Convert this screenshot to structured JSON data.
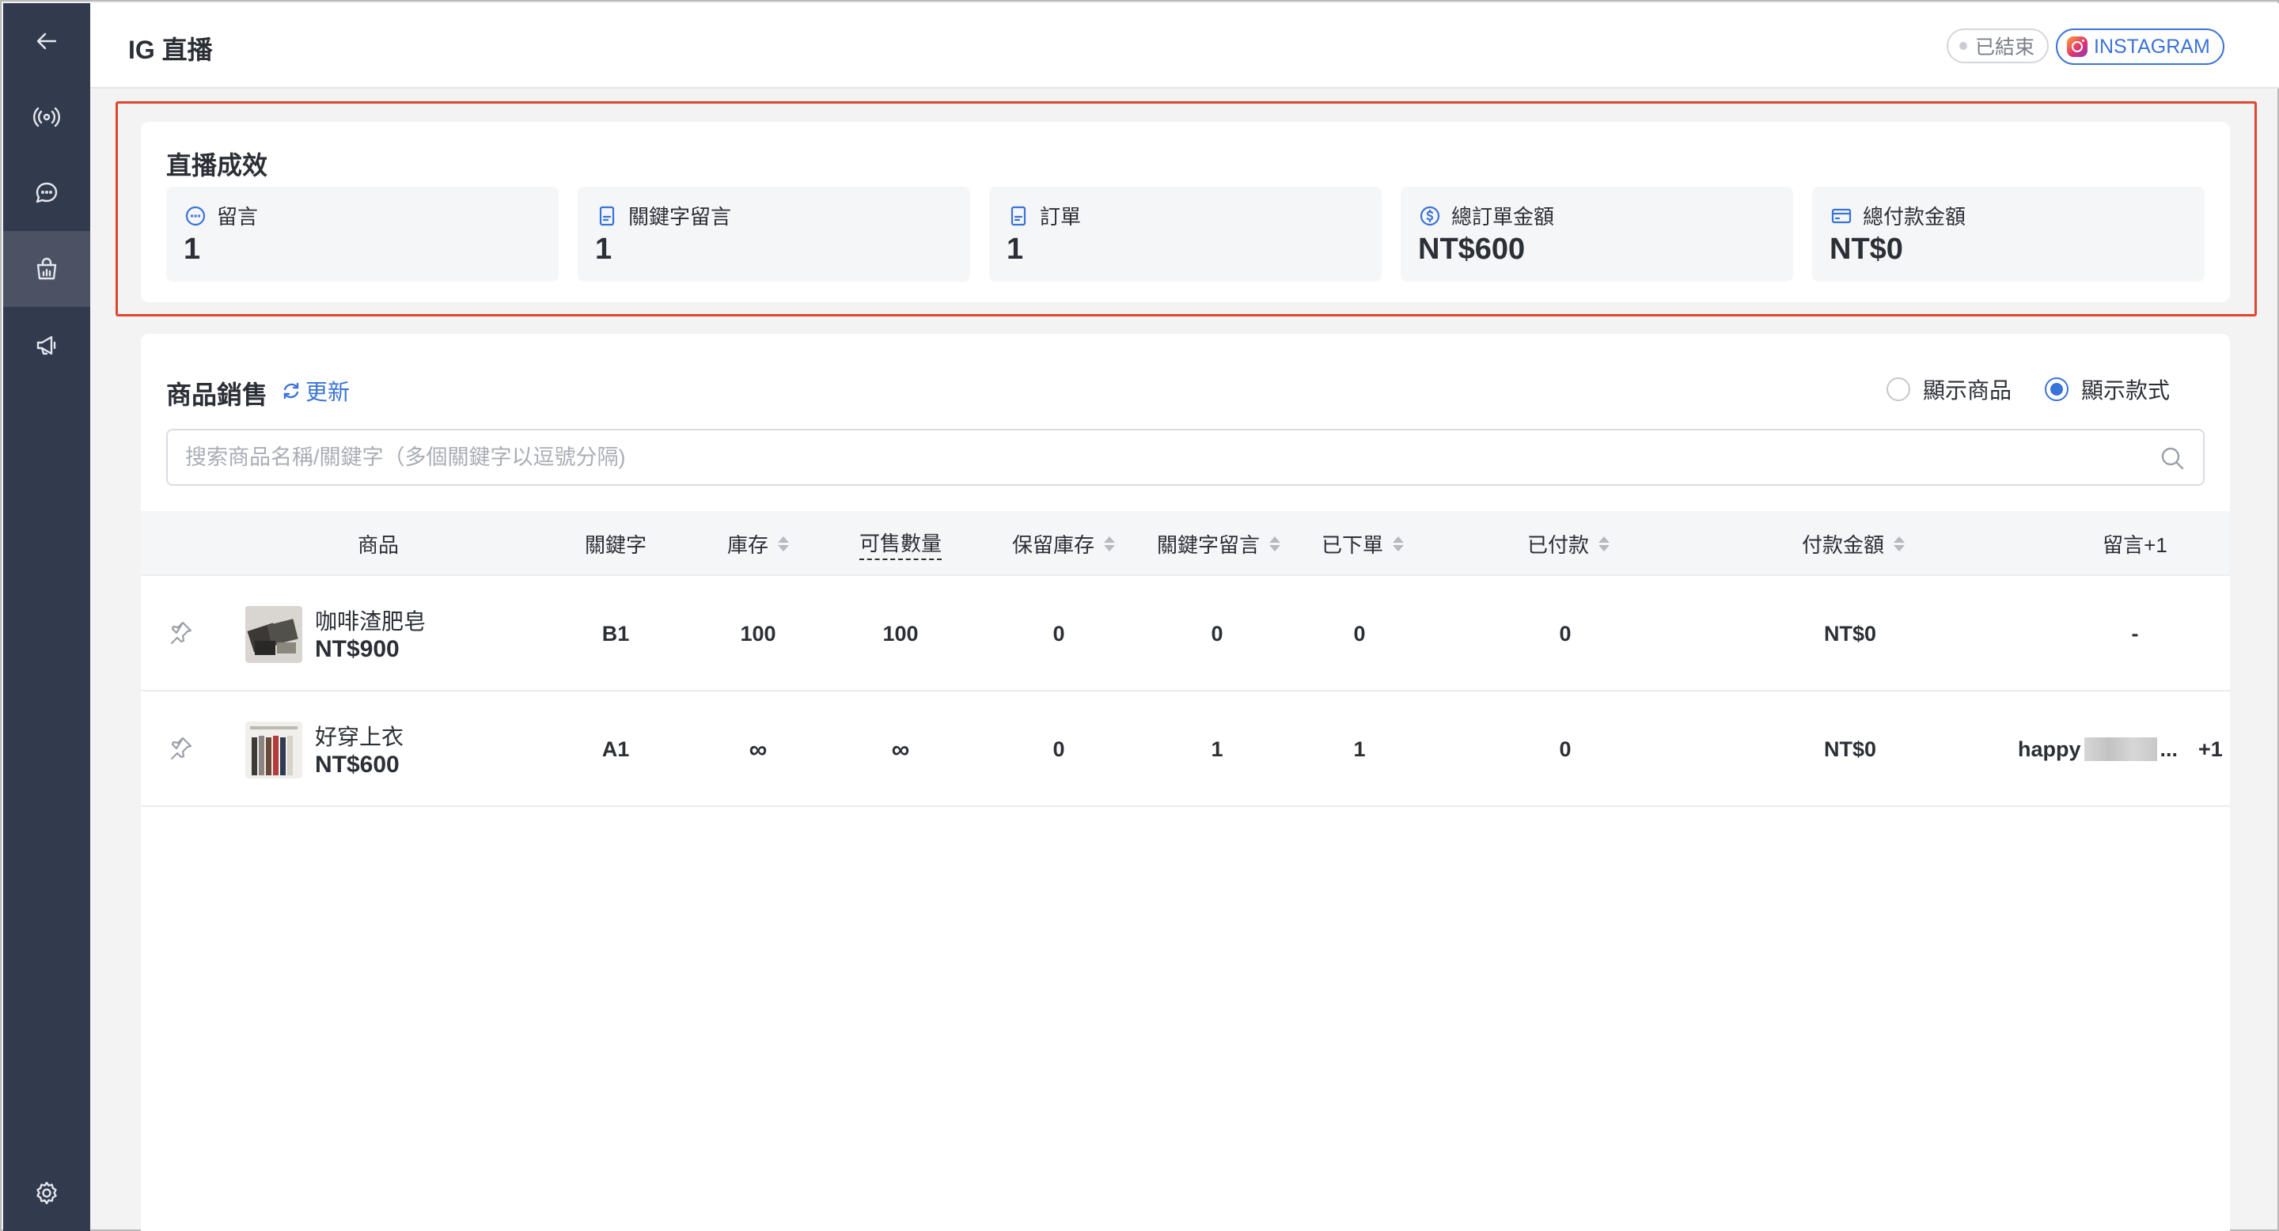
{
  "header": {
    "title": "IG 直播",
    "status": "已結束",
    "platform": "INSTAGRAM"
  },
  "sidebar": {
    "items": [
      {
        "icon": "back-arrow-icon"
      },
      {
        "icon": "broadcast-icon"
      },
      {
        "icon": "chat-bubble-icon"
      },
      {
        "icon": "shopping-bag-chart-icon",
        "active": true
      },
      {
        "icon": "megaphone-icon"
      },
      {
        "icon": "gear-icon"
      }
    ]
  },
  "performance": {
    "title": "直播成效",
    "stats": [
      {
        "icon": "comment-icon",
        "label": "留言",
        "value": "1"
      },
      {
        "icon": "document-icon",
        "label": "關鍵字留言",
        "value": "1"
      },
      {
        "icon": "document-icon",
        "label": "訂單",
        "value": "1"
      },
      {
        "icon": "dollar-circle-icon",
        "label": "總訂單金額",
        "value": "NT$600"
      },
      {
        "icon": "credit-card-icon",
        "label": "總付款金額",
        "value": "NT$0"
      }
    ]
  },
  "sales": {
    "title": "商品銷售",
    "refresh_label": "更新",
    "radio_products": "顯示商品",
    "radio_variants": "顯示款式",
    "selected_view": "顯示款式",
    "search_placeholder": "搜索商品名稱/關鍵字（多個關鍵字以逗號分隔)"
  },
  "table": {
    "columns": {
      "product": "商品",
      "keyword": "關鍵字",
      "stock": "庫存",
      "sellable": "可售數量",
      "reserved": "保留庫存",
      "keyword_comments": "關鍵字留言",
      "ordered": "已下單",
      "paid": "已付款",
      "paid_amount": "付款金額",
      "comments": "留言+1"
    },
    "rows": [
      {
        "name": "咖啡渣肥皂",
        "price": "NT$900",
        "keyword": "B1",
        "stock": "100",
        "sellable": "100",
        "reserved": "0",
        "keyword_comments": "0",
        "ordered": "0",
        "paid": "0",
        "paid_amount": "NT$0",
        "comments": "-"
      },
      {
        "name": "好穿上衣",
        "price": "NT$600",
        "keyword": "A1",
        "stock": "∞",
        "sellable": "∞",
        "reserved": "0",
        "keyword_comments": "1",
        "ordered": "1",
        "paid": "0",
        "paid_amount": "NT$0",
        "comments_prefix": "happy",
        "comments_suffix": "...",
        "comments_extra": "+1"
      }
    ]
  },
  "colors": {
    "sidebar": "#323a4d",
    "accent": "#3a73d8",
    "highlight": "#e0452f"
  }
}
